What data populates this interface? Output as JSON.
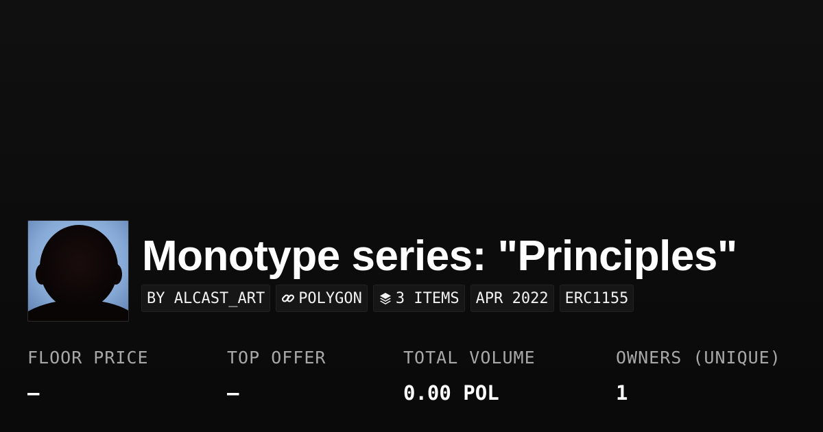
{
  "collection": {
    "title": "Monotype series: \"Principles\"",
    "avatar_icon": "portrait-silhouette-image"
  },
  "tags": {
    "creator": "BY ALCAST_ART",
    "chain": "POLYGON",
    "chain_icon": "link-icon",
    "items": "3 ITEMS",
    "items_icon": "layers-icon",
    "date": "APR 2022",
    "standard": "ERC1155"
  },
  "stats": {
    "floor_price": {
      "label": "FLOOR PRICE",
      "value": "–"
    },
    "top_offer": {
      "label": "TOP OFFER",
      "value": "–"
    },
    "total_volume": {
      "label": "TOTAL VOLUME",
      "value": "0.00 POL"
    },
    "owners": {
      "label": "OWNERS (UNIQUE)",
      "value": "1"
    }
  },
  "colors": {
    "background": "#0b0b0b",
    "tag_background": "#161616",
    "label_gray": "#a8a8a8",
    "text": "#ffffff"
  }
}
